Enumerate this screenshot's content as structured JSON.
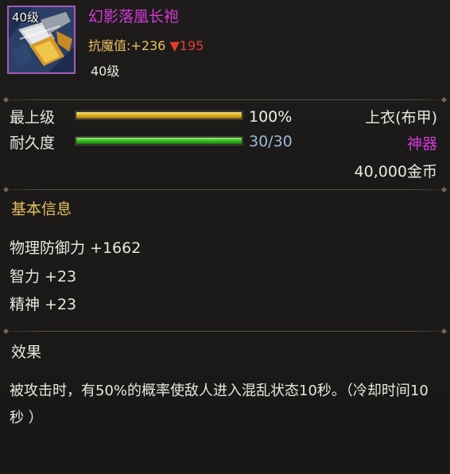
{
  "item": {
    "icon_name": "robe-item-icon",
    "icon_level": "40级",
    "name": "幻影落凰长袍",
    "name_color": "#d33ad9",
    "attr_label": "抗魔值:",
    "attr_value": "+236",
    "attr_down": "▼195",
    "required_level": "40级"
  },
  "stats": {
    "top_level_label": "最上级",
    "top_level_value": "100%",
    "top_level_fraction": 1.0,
    "durability_label": "耐久度",
    "durability_value": "30/30",
    "durability_fraction": 1.0,
    "slot_type": "上衣(布甲)",
    "grade": "神器",
    "price": "40,000金币"
  },
  "basic_info": {
    "title": "基本信息",
    "properties": [
      "物理防御力 +1662",
      "智力 +23",
      "精神 +23"
    ]
  },
  "effect": {
    "title": "效果",
    "description": "被攻击时，有50%的概率使敌人进入混乱状态10秒。（冷却时间10秒 ）"
  },
  "colors": {
    "grade_purple": "#d33ad9",
    "gold": "#e8c062",
    "down_red": "#e53c2f"
  }
}
